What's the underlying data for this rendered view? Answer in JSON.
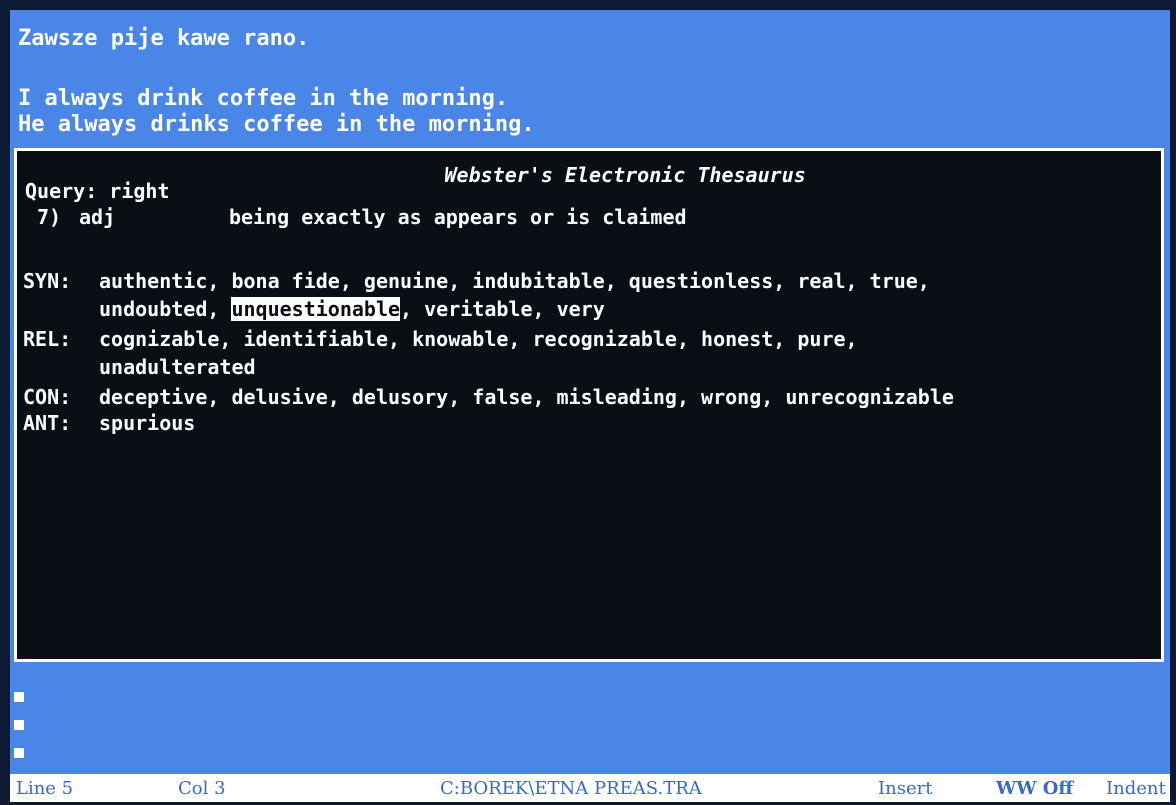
{
  "editor": {
    "line1": "Zawsze pije kawe rano.",
    "line2": "I always drink coffee in the morning.",
    "line3": "He always drinks coffee in the morning."
  },
  "thesaurus": {
    "title": "Webster's Electronic Thesaurus",
    "query_label": "Query:",
    "query_value": "right",
    "sense_number": "7)",
    "part_of_speech": "adj",
    "definition": "being exactly as appears or is claimed",
    "sections": {
      "syn": {
        "label": "SYN:",
        "line1": "authentic, bona fide, genuine, indubitable, questionless, real, true,",
        "line2_pre": "undoubted,",
        "highlighted": "unquestionable",
        "line2_post": ", veritable, very"
      },
      "rel": {
        "label": "REL:",
        "line1": "cognizable, identifiable, knowable, recognizable, honest, pure,",
        "line2": "unadulterated"
      },
      "con": {
        "label": "CON:",
        "line1": "deceptive, delusive, delusory, false, misleading, wrong, unrecognizable"
      },
      "ant": {
        "label": "ANT:",
        "line1": "spurious"
      }
    }
  },
  "status_bar": {
    "line": "Line 5",
    "col": "Col 3",
    "file_path": "C:BOREK\\ETNA PREAS.TRA",
    "mode": "Insert",
    "ww": "WW Off",
    "indent": "Indent"
  }
}
